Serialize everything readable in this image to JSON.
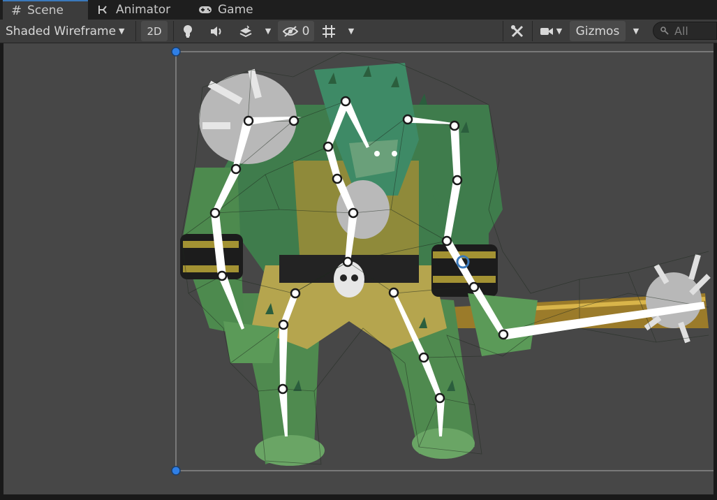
{
  "tabs": [
    {
      "label": "Scene",
      "icon": "hash-icon",
      "active": true
    },
    {
      "label": "Animator",
      "icon": "animator-icon",
      "active": false
    },
    {
      "label": "Game",
      "icon": "gamepad-icon",
      "active": false
    }
  ],
  "toolbar": {
    "draw_mode": "Shaded Wireframe",
    "mode_2d": "2D",
    "hidden_count": "0",
    "gizmos_label": "Gizmos",
    "search_placeholder": "All"
  },
  "colors": {
    "panel": "#3c3c3c",
    "viewport": "#474747",
    "accent": "#3a79bb",
    "bone": "#ffffff"
  }
}
